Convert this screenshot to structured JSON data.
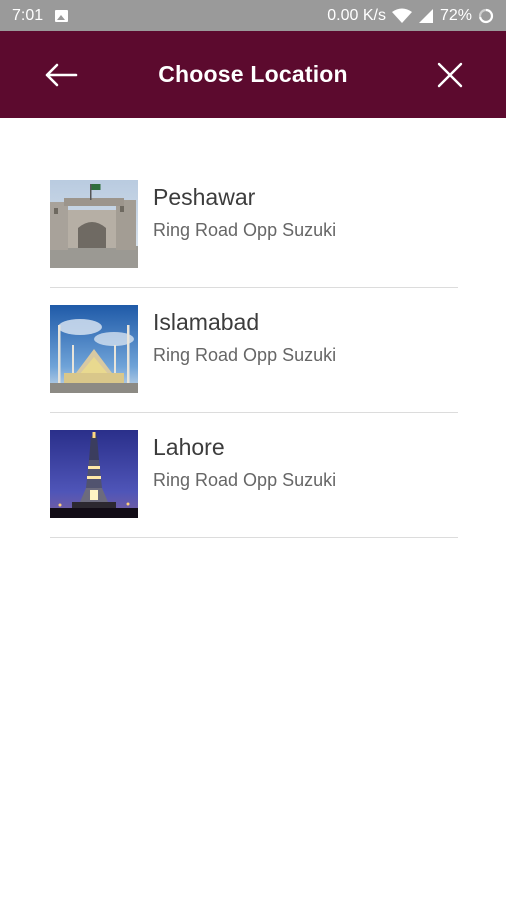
{
  "status_bar": {
    "time": "7:01",
    "speed": "0.00 K/s",
    "battery": "72%"
  },
  "app_bar": {
    "title": "Choose Location",
    "back_icon": "arrow-back-icon",
    "close_icon": "close-icon",
    "color": "#5c0a2e"
  },
  "locations": [
    {
      "city": "Peshawar",
      "address": "Ring Road Opp Suzuki",
      "image": "peshawar-gate-image"
    },
    {
      "city": "Islamabad",
      "address": "Ring Road Opp Suzuki",
      "image": "islamabad-mosque-image"
    },
    {
      "city": "Lahore",
      "address": "Ring Road Opp Suzuki",
      "image": "lahore-minar-image"
    }
  ]
}
